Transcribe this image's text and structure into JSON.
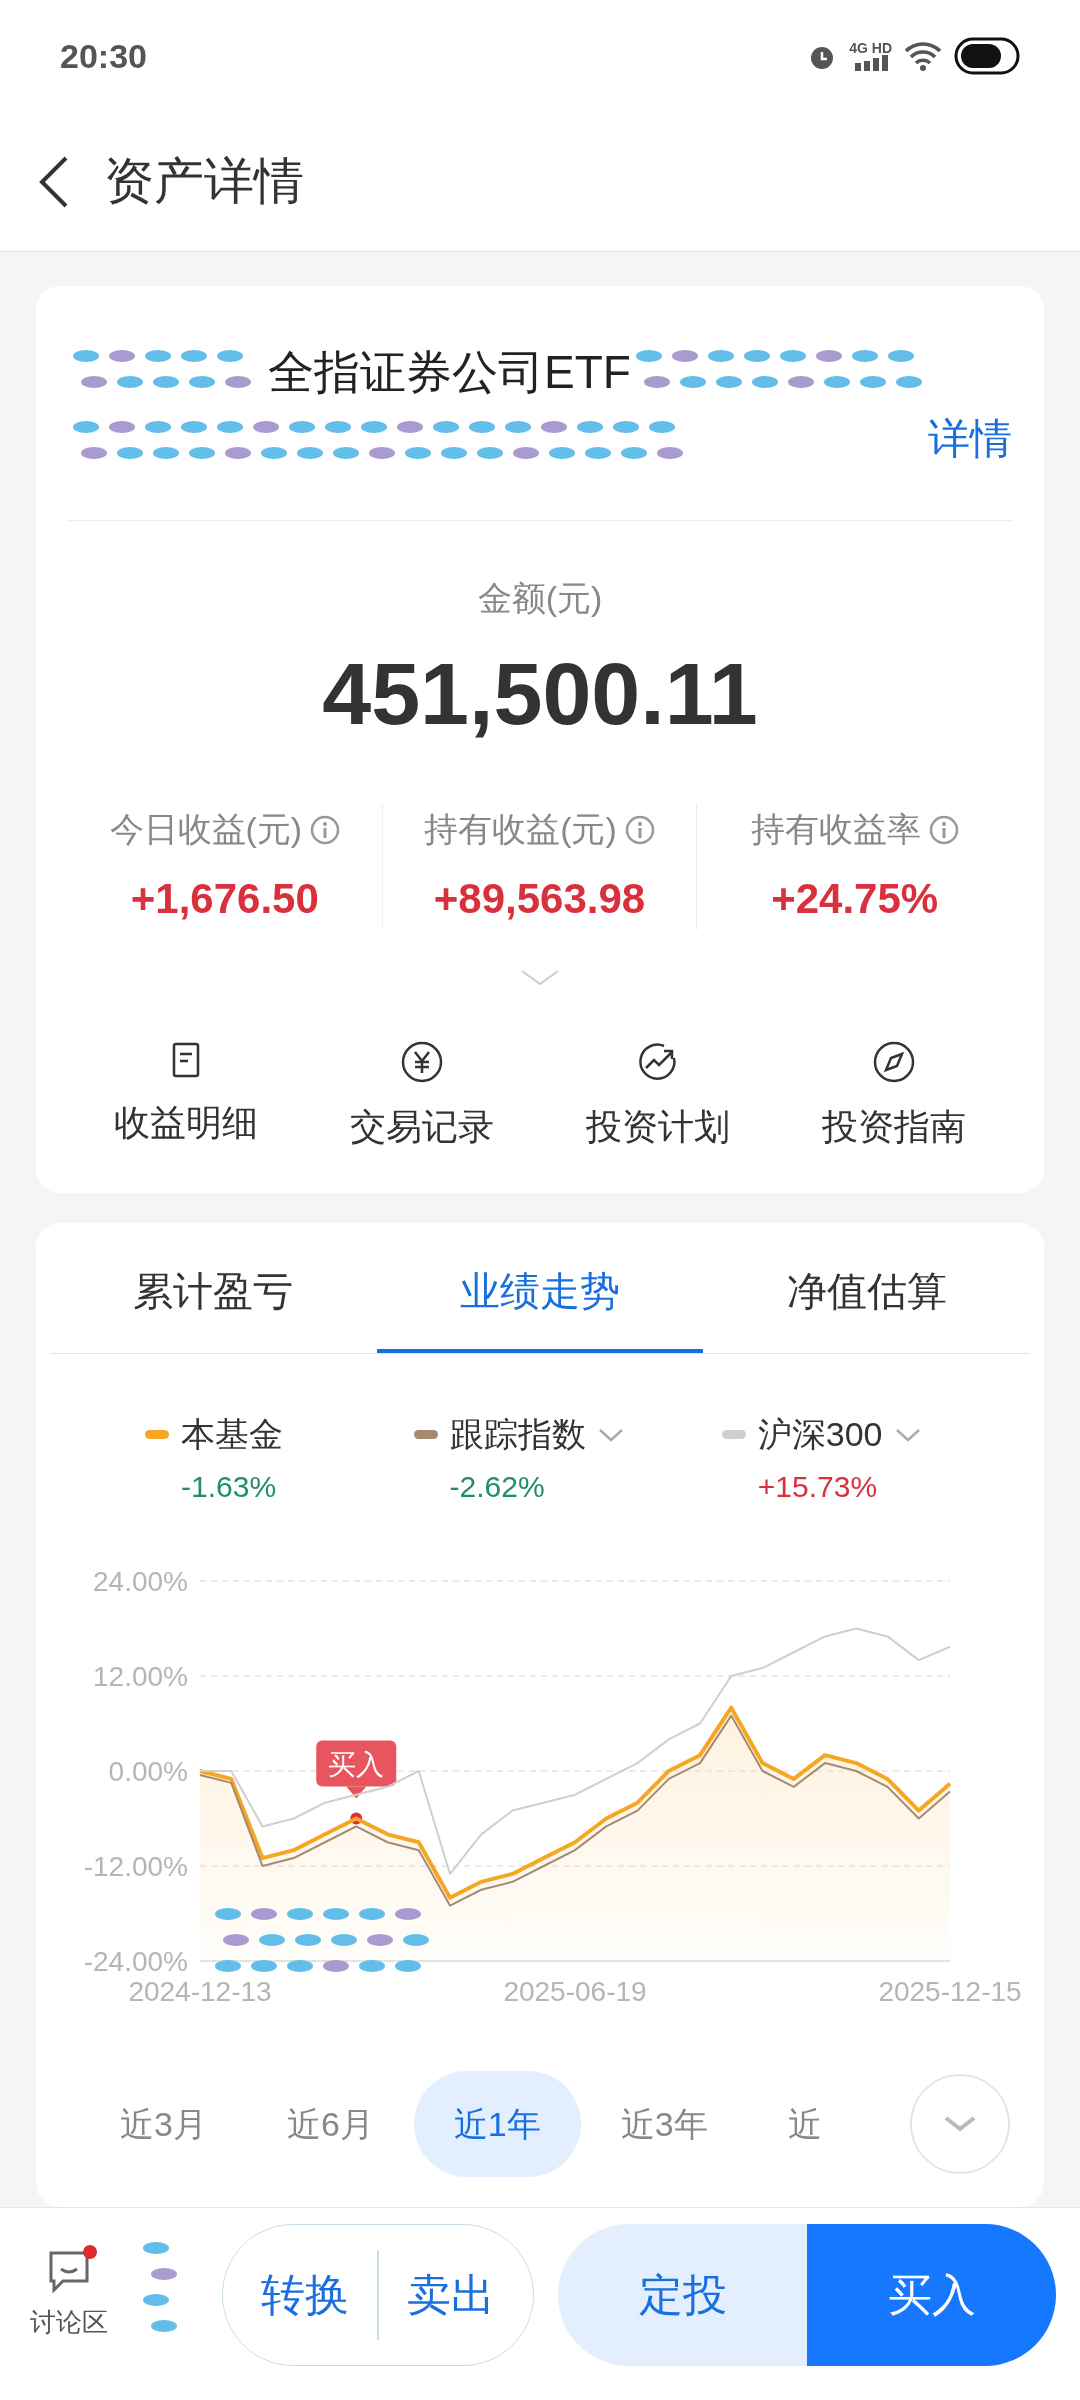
{
  "status_bar": {
    "time": "20:30",
    "network": "4G HD"
  },
  "header": {
    "title": "资产详情"
  },
  "fund_card": {
    "name": "全指证券公司ETF",
    "detail_link": "详情",
    "amount_label": "金额(元)",
    "amount": "451,500.11",
    "stats": [
      {
        "label": "今日收益(元)",
        "value": "+1,676.50"
      },
      {
        "label": "持有收益(元)",
        "value": "+89,563.98"
      },
      {
        "label": "持有收益率",
        "value": "+24.75%"
      }
    ],
    "actions": [
      {
        "kind": "doc",
        "label": "收益明细"
      },
      {
        "kind": "yuan",
        "label": "交易记录"
      },
      {
        "kind": "trend",
        "label": "投资计划"
      },
      {
        "kind": "compass",
        "label": "投资指南"
      }
    ]
  },
  "chart_card": {
    "tabs": [
      {
        "label": "累计盈亏",
        "selected": false
      },
      {
        "label": "业绩走势",
        "selected": true
      },
      {
        "label": "净值估算",
        "selected": false
      }
    ],
    "legend": [
      {
        "value": "-1.63%",
        "dropdown": false,
        "gain": false
      },
      {
        "value": "-2.62%",
        "dropdown": true,
        "gain": false
      },
      {
        "value": "+15.73%",
        "dropdown": true,
        "gain": true
      }
    ],
    "chart_data": {
      "type": "line",
      "grid": true,
      "categories": [
        "2024-12-13",
        null,
        null,
        null,
        null,
        null,
        null,
        null,
        null,
        null,
        null,
        null,
        "2025-06-19",
        null,
        null,
        null,
        null,
        null,
        null,
        null,
        null,
        null,
        null,
        null,
        "2025-12-15"
      ],
      "ylim": [
        -24,
        24
      ],
      "yticks": [
        {
          "value": 24,
          "label": "24.00%"
        },
        {
          "value": 12,
          "label": "12.00%"
        },
        {
          "value": 0,
          "label": "0.00%"
        },
        {
          "value": -12,
          "label": "-12.00%"
        },
        {
          "value": -24,
          "label": "-24.00%"
        }
      ],
      "series": [
        {
          "name": "本基金",
          "color": "#f5a623",
          "values": [
            0,
            -1,
            -11,
            -10,
            -8,
            -6,
            -8,
            -9,
            -16,
            -14,
            -13,
            -11,
            -9,
            -6,
            -4,
            0,
            2,
            8,
            1,
            -1,
            2,
            1,
            -1,
            -5,
            -1.6
          ]
        },
        {
          "name": "跟踪指数",
          "color": "#a68a6f",
          "values": [
            -0.5,
            -1.5,
            -12,
            -11,
            -9,
            -7,
            -9,
            -10,
            -17,
            -15,
            -14,
            -12,
            -10,
            -7,
            -5,
            -1,
            1,
            7,
            0,
            -2,
            1,
            0,
            -2,
            -6,
            -2.6
          ]
        },
        {
          "name": "沪深300",
          "color": "#cfcfcf",
          "values": [
            0,
            0,
            -7,
            -6,
            -4,
            -3,
            -2,
            0,
            -13,
            -8,
            -5,
            -4,
            -3,
            -1,
            1,
            4,
            6,
            12,
            13,
            15,
            17,
            18,
            17,
            14,
            15.7
          ]
        }
      ],
      "annotations": [
        "买入"
      ]
    },
    "ranges": [
      {
        "label": "近3月",
        "selected": false
      },
      {
        "label": "近6月",
        "selected": false
      },
      {
        "label": "近1年",
        "selected": true
      },
      {
        "label": "近3年",
        "selected": false
      },
      {
        "label": "近",
        "selected": false
      }
    ]
  },
  "bottom_bar": {
    "discuss": {
      "label": "讨论区",
      "unread": true
    },
    "buttons": [
      {
        "kind": "outline",
        "label": "转换"
      },
      {
        "kind": "outline",
        "label": "卖出"
      },
      {
        "kind": "light",
        "label": "定投"
      },
      {
        "kind": "primary",
        "label": "买入"
      }
    ]
  }
}
